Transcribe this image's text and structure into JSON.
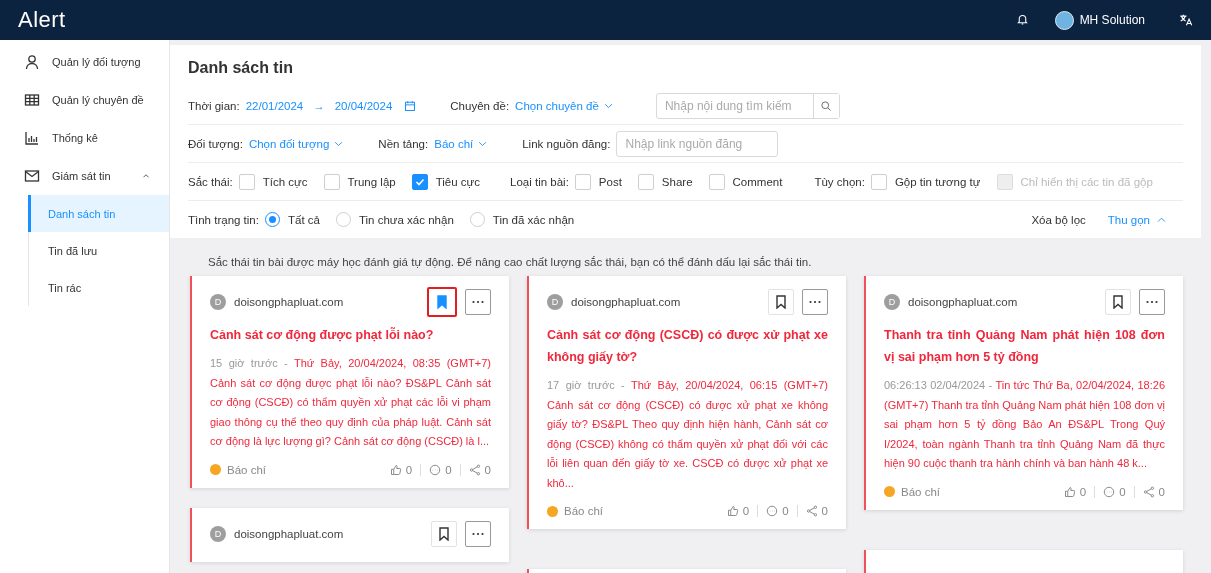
{
  "header": {
    "logo": "Alert",
    "user_name": "MH Solution"
  },
  "sidebar": {
    "items": [
      {
        "label": "Quản lý đối tượng",
        "kind": "user",
        "selected": false
      },
      {
        "label": "Quản lý chuyên đề",
        "kind": "table",
        "selected": false
      },
      {
        "label": "Thống kê",
        "kind": "chart",
        "selected": false
      },
      {
        "label": "Giám sát tin",
        "kind": "mail",
        "selected": false,
        "expanded": true,
        "children": [
          {
            "label": "Danh sách tin",
            "selected": true
          },
          {
            "label": "Tin đã lưu",
            "selected": false
          },
          {
            "label": "Tin rác",
            "selected": false
          }
        ]
      }
    ]
  },
  "filters": {
    "title": "Danh sách tin",
    "time": {
      "label": "Thời gian:",
      "from": "22/01/2024",
      "arrow": "→",
      "to": "20/04/2024"
    },
    "topic": {
      "label": "Chuyên đề:",
      "value": "Chọn chuyên đề"
    },
    "search": {
      "placeholder": "Nhập nội dung tìm kiếm"
    },
    "target": {
      "label": "Đối tượng:",
      "value": "Chọn đối tượng"
    },
    "platform": {
      "label": "Nền tảng:",
      "value": "Báo chí"
    },
    "link": {
      "label": "Link nguồn đăng:",
      "placeholder": "Nhập link nguồn đăng"
    },
    "sentiment": {
      "label": "Sắc thái:",
      "options": [
        {
          "label": "Tích cực",
          "checked": false,
          "disabled": false
        },
        {
          "label": "Trung lập",
          "checked": false,
          "disabled": false
        },
        {
          "label": "Tiêu cực",
          "checked": true,
          "disabled": false
        }
      ]
    },
    "post_type": {
      "label": "Loại tin bài:",
      "options": [
        {
          "label": "Post",
          "checked": false,
          "disabled": false
        },
        {
          "label": "Share",
          "checked": false,
          "disabled": false
        },
        {
          "label": "Comment",
          "checked": false,
          "disabled": false
        }
      ]
    },
    "options": {
      "label": "Tùy chọn:",
      "options": [
        {
          "label": "Gộp tin tương tự",
          "checked": false,
          "disabled": false
        },
        {
          "label": "Chỉ hiển thị các tin đã gộp",
          "checked": false,
          "disabled": true
        }
      ]
    },
    "status": {
      "label": "Tình trạng tin:",
      "options": [
        {
          "label": "Tất cả",
          "selected": true
        },
        {
          "label": "Tin chưa xác nhận",
          "selected": false
        },
        {
          "label": "Tin đã xác nhận",
          "selected": false
        }
      ]
    },
    "clear": "Xóa bộ lọc",
    "collapse": "Thu gọn"
  },
  "notice": "Sắc thái tin bài được máy học đánh giá tự động. Để nâng cao chất lượng sắc thái, bạn có thể đánh dấu lại sắc thái tin.",
  "columns": [
    {
      "cards": [
        {
          "kind": "full",
          "source_initial": "D",
          "source": "doisongphapluat.com",
          "bookmarked": true,
          "highlighted": true,
          "title": "Cảnh sát cơ động được phạt lỗi nào?",
          "time": "15 giờ trước",
          "separator": "-",
          "body": "Thứ Bảy, 20/04/2024, 08:35 (GMT+7) Cảnh sát cơ động được phạt lỗi nào? ĐS&PL Cảnh sát cơ động (CSCĐ) có thẩm quyền xử phạt các lỗi vi phạm giao thông cụ thể theo quy định của pháp luật. Cảnh sát cơ động là lực lượng gì? Cảnh sát cơ động (CSCĐ) là l...",
          "platform": "Báo chí",
          "likes": "0",
          "comments": "0",
          "shares": "0"
        },
        {
          "kind": "cut",
          "source_initial": "D",
          "source": "doisongphapluat.com",
          "bookmarked": false,
          "highlighted": false
        }
      ]
    },
    {
      "cards": [
        {
          "kind": "full",
          "source_initial": "D",
          "source": "doisongphapluat.com",
          "bookmarked": false,
          "highlighted": false,
          "title": "Cảnh sát cơ động (CSCĐ) có được xử phạt xe không giấy tờ?",
          "time": "17 giờ trước",
          "separator": "-",
          "body": "Thứ Bảy, 20/04/2024, 06:15 (GMT+7) Cảnh sát cơ động (CSCĐ) có được xử phạt xe không giấy tờ? ĐS&PL Theo quy định hiện hành, Cảnh sát cơ động (CSCĐ) không có thẩm quyền xử phạt đối với các lỗi liên quan đến giấy tờ xe. CSCĐ có được xử phạt xe khô...",
          "platform": "Báo chí",
          "likes": "0",
          "comments": "0",
          "shares": "0"
        },
        {
          "kind": "blank"
        }
      ]
    },
    {
      "cards": [
        {
          "kind": "full",
          "source_initial": "D",
          "source": "doisongphapluat.com",
          "bookmarked": false,
          "highlighted": false,
          "title": "Thanh tra tỉnh Quảng Nam phát hiện 108 đơn vị sai phạm hơn 5 tỷ đồng",
          "time": "06:26:13  02/04/2024",
          "separator": "-",
          "body": "Tin tức Thứ Ba, 02/04/2024, 18:26 (GMT+7) Thanh tra tỉnh Quảng Nam phát hiện 108 đơn vị sai phạm hơn 5 tỷ đồng Bảo An ĐS&PL Trong Quý I/2024, toàn ngành Thanh tra tỉnh Quảng Nam đã thực hiện 90 cuộc thanh tra hành chính và ban hành 48 k...",
          "platform": "Báo chí",
          "likes": "0",
          "comments": "0",
          "shares": "0"
        },
        {
          "kind": "blank"
        }
      ]
    }
  ]
}
